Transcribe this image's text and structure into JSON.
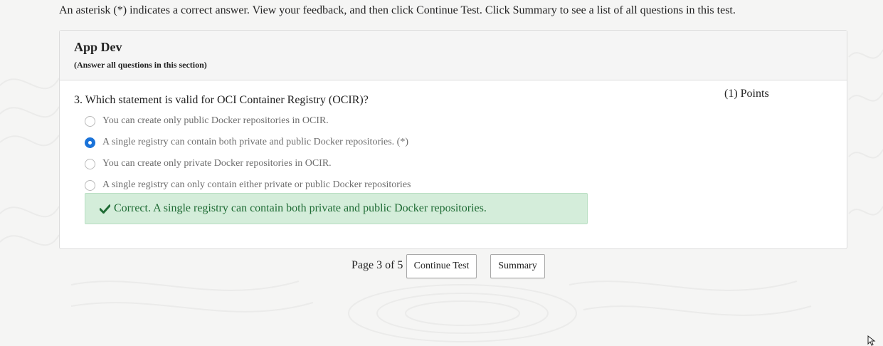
{
  "instructions": "An asterisk (*) indicates a correct answer. View your feedback, and then click Continue Test. Click Summary to see a list of all questions in this test.",
  "section": {
    "title": "App Dev",
    "subtitle": "(Answer all questions in this section)"
  },
  "question": {
    "text": "3. Which statement is valid for OCI Container Registry (OCIR)?",
    "points": "(1) Points",
    "options": [
      {
        "label": "You can create only public Docker repositories in OCIR.",
        "selected": false
      },
      {
        "label": "A single registry can contain both private and public Docker repositories. (*)",
        "selected": true
      },
      {
        "label": "You can create only private Docker repositories in OCIR.",
        "selected": false
      },
      {
        "label": "A single registry can only contain either private or public Docker repositories",
        "selected": false
      }
    ],
    "feedback": {
      "icon": "check-icon",
      "text": "Correct. A single registry can contain both private and public Docker repositories."
    }
  },
  "pager": {
    "text": "Page 3 of 5",
    "continue_label": "Continue Test",
    "summary_label": "Summary"
  },
  "colors": {
    "accent": "#1a73d9",
    "success_bg": "#d4edda",
    "success_text": "#1e6b34"
  }
}
